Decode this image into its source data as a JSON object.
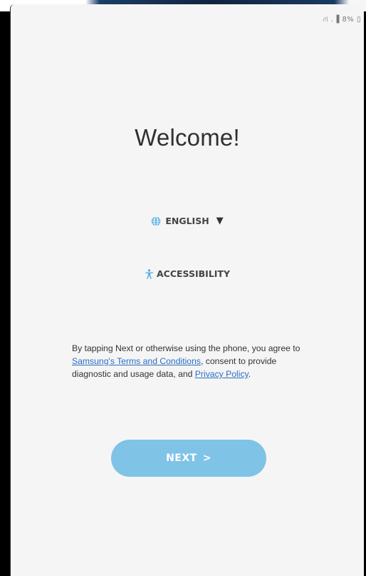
{
  "status_bar": {
    "text": "⛙ .▐ 8% ▯"
  },
  "welcome": {
    "title": "Welcome!"
  },
  "language": {
    "label": "ENGLISH",
    "caret": "▼"
  },
  "accessibility": {
    "label": "ACCESSIBILITY"
  },
  "terms": {
    "part1": "By tapping Next or otherwise using the phone, you agree to ",
    "link1": "Samsung's Terms and Conditions",
    "part2": ", consent to provide diagnostic and usage data, and ",
    "link2": "Privacy Policy",
    "part3": "."
  },
  "next_button": {
    "label": "NEXT",
    "chevron": ">"
  },
  "colors": {
    "button": "#7fc3e6",
    "link": "#2a6fc0",
    "globe": "#5aaee0",
    "background": "#f5f5f6"
  }
}
